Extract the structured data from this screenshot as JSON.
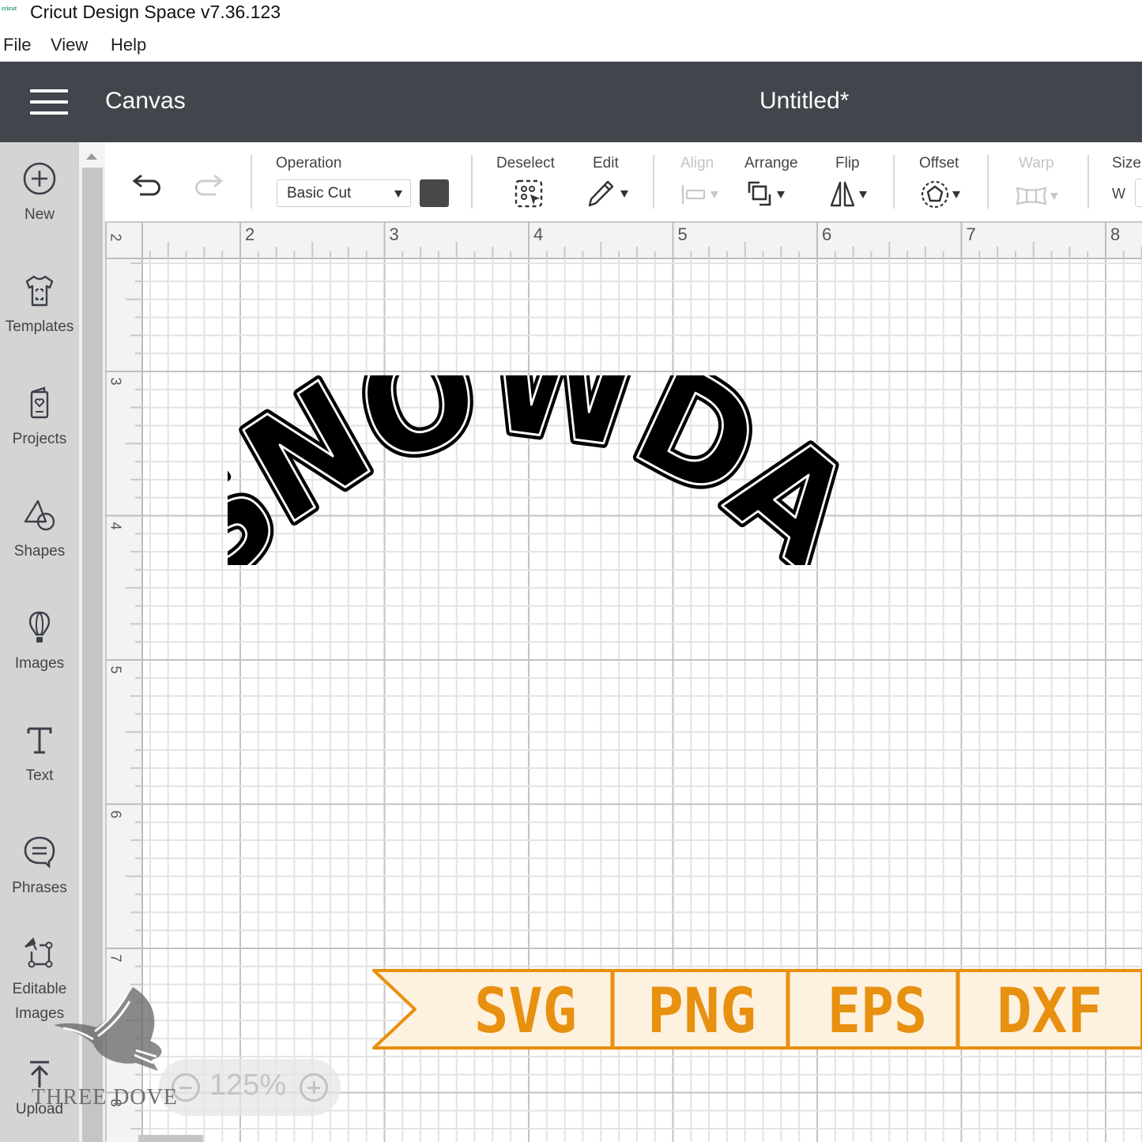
{
  "window": {
    "app_title": "Cricut Design Space  v7.36.123",
    "logo_text": "cricut"
  },
  "menu": [
    "File",
    "View",
    "Help"
  ],
  "header": {
    "section": "Canvas",
    "document_title": "Untitled*"
  },
  "sidebar": {
    "items": [
      {
        "label": "New",
        "icon": "plus-circle-icon"
      },
      {
        "label": "Templates",
        "icon": "tshirt-icon"
      },
      {
        "label": "Projects",
        "icon": "card-heart-icon"
      },
      {
        "label": "Shapes",
        "icon": "shapes-icon"
      },
      {
        "label": "Images",
        "icon": "balloon-icon"
      },
      {
        "label": "Text",
        "icon": "text-t-icon"
      },
      {
        "label": "Phrases",
        "icon": "speech-bubble-icon"
      },
      {
        "label": "Editable Images",
        "icon": "editable-image-icon"
      },
      {
        "label": "Upload",
        "icon": "upload-icon"
      }
    ]
  },
  "toolbar": {
    "undo_icon": "undo-icon",
    "redo_icon": "redo-icon",
    "operation_label": "Operation",
    "operation_value": "Basic Cut",
    "color": "#484848",
    "deselect_label": "Deselect",
    "edit_label": "Edit",
    "align_label": "Align",
    "arrange_label": "Arrange",
    "flip_label": "Flip",
    "offset_label": "Offset",
    "warp_label": "Warp",
    "size_label": "Size",
    "size_w_label": "W"
  },
  "canvas": {
    "ruler_top": [
      "2",
      "3",
      "4",
      "5",
      "6",
      "7",
      "8"
    ],
    "ruler_left": [
      "2",
      "3",
      "4",
      "5",
      "6",
      "7",
      "8"
    ],
    "design_text": "SNOWDAY",
    "zoom": "125%"
  },
  "banner": {
    "formats": [
      "SVG",
      "PNG",
      "EPS",
      "DXF"
    ],
    "color": "#e8900f",
    "background": "#fdf1df"
  },
  "watermark": "THREE DOVE"
}
